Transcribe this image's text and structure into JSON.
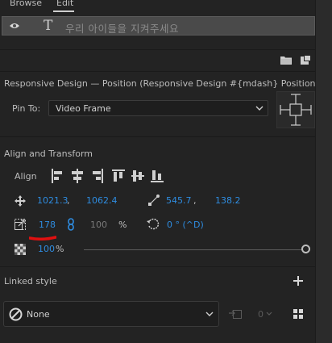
{
  "tabs": {
    "browse": "Browse",
    "edit": "Edit"
  },
  "layer": {
    "type_glyph": "T",
    "name": "우리 아이들을 지켜주세요"
  },
  "responsive": {
    "title": "Responsive Design — Position (Responsive Design #{mdash} Position)",
    "pin_to_label": "Pin To:",
    "pin_to_value": "Video Frame"
  },
  "align_transform": {
    "title": "Align and Transform",
    "align_label": "Align",
    "position_x": "1021.3",
    "position_comma": ",",
    "position_y": "1062.4",
    "anchor_x": "545.7",
    "anchor_comma": ",",
    "anchor_y": "138.2",
    "scale_w": "178",
    "scale_h": "100",
    "scale_unit": "%",
    "rotation": "0 ° (^D)",
    "opacity": "100",
    "opacity_unit": "%",
    "opacity_level": 1.0
  },
  "linked_style": {
    "title": "Linked style",
    "value": "None",
    "stepper_value": "0"
  },
  "colors": {
    "accent": "#2e8ce0",
    "annotation": "#e01010"
  }
}
